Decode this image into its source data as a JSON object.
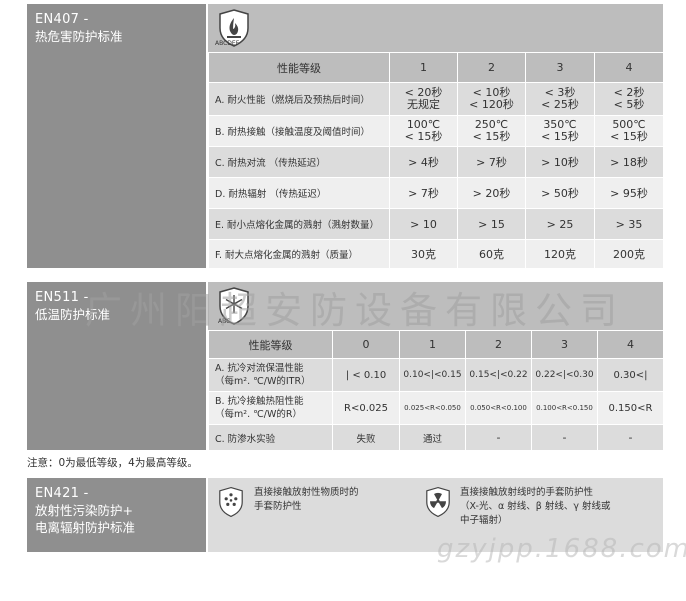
{
  "en407": {
    "code": "EN407 -",
    "title": "热危害防护标准",
    "icon_label": "ABCDEF",
    "header": {
      "label": "性能等级",
      "levels": [
        "1",
        "2",
        "3",
        "4"
      ]
    },
    "rows": [
      {
        "label": "A. 耐火性能（燃烧后及预热后时间）",
        "values": [
          "< 20秒\n无规定",
          "< 10秒\n< 120秒",
          "< 3秒\n< 25秒",
          "< 2秒\n< 5秒"
        ]
      },
      {
        "label": "B. 耐热接触（接触温度及阈值时间）",
        "values": [
          "100℃\n< 15秒",
          "250℃\n< 15秒",
          "350℃\n< 15秒",
          "500℃\n< 15秒"
        ]
      },
      {
        "label": "C. 耐热对流 （传热延迟）",
        "values": [
          "> 4秒",
          "> 7秒",
          "> 10秒",
          "> 18秒"
        ]
      },
      {
        "label": "D. 耐热辐射 （传热延迟）",
        "values": [
          "> 7秒",
          "> 20秒",
          "> 50秒",
          "> 95秒"
        ]
      },
      {
        "label": "E. 耐小点熔化金属的溅射（溅射数量）",
        "values": [
          "> 10",
          "> 15",
          "> 25",
          "> 35"
        ]
      },
      {
        "label": "F. 耐大点熔化金属的溅射（质量）",
        "values": [
          "30克",
          "60克",
          "120克",
          "200克"
        ]
      }
    ]
  },
  "en511": {
    "code": "EN511 -",
    "title": "低温防护标准",
    "icon_label": "ABC",
    "header": {
      "label": "性能等级",
      "levels": [
        "0",
        "1",
        "2",
        "3",
        "4"
      ]
    },
    "rows": [
      {
        "label": "A. 抗冷对流保温性能\n（每m². ℃/W的ITR）",
        "values": [
          "| < 0.10",
          "0.10<|<0.15",
          "0.15<|<0.22",
          "0.22<|<0.30",
          "0.30<|"
        ]
      },
      {
        "label": "B. 抗冷接触热阻性能\n（每m². ℃/W的R）",
        "values": [
          "R<0.025",
          "0.025<R<0.050",
          "0.050<R<0.100",
          "0.100<R<0.150",
          "0.150<R"
        ]
      },
      {
        "label": "C. 防渗水实验",
        "values": [
          "失败",
          "通过",
          "-",
          "-",
          "-"
        ]
      }
    ]
  },
  "note": "注意：0为最低等级，4为最高等级。",
  "en421": {
    "code": "EN421 -",
    "title1": "放射性污染防护+",
    "title2": "电离辐射防护标准",
    "item1": [
      "直接接触放射性物质时的",
      "手套防护性"
    ],
    "item2": [
      "直接接触放射线时的手套防护性",
      "（X-光、α 射线、β 射线、γ 射线或",
      "中子辐射）"
    ]
  },
  "watermark": "广州阳超安防设备有限公司",
  "watermark2": "gzyjpp.1688.com"
}
